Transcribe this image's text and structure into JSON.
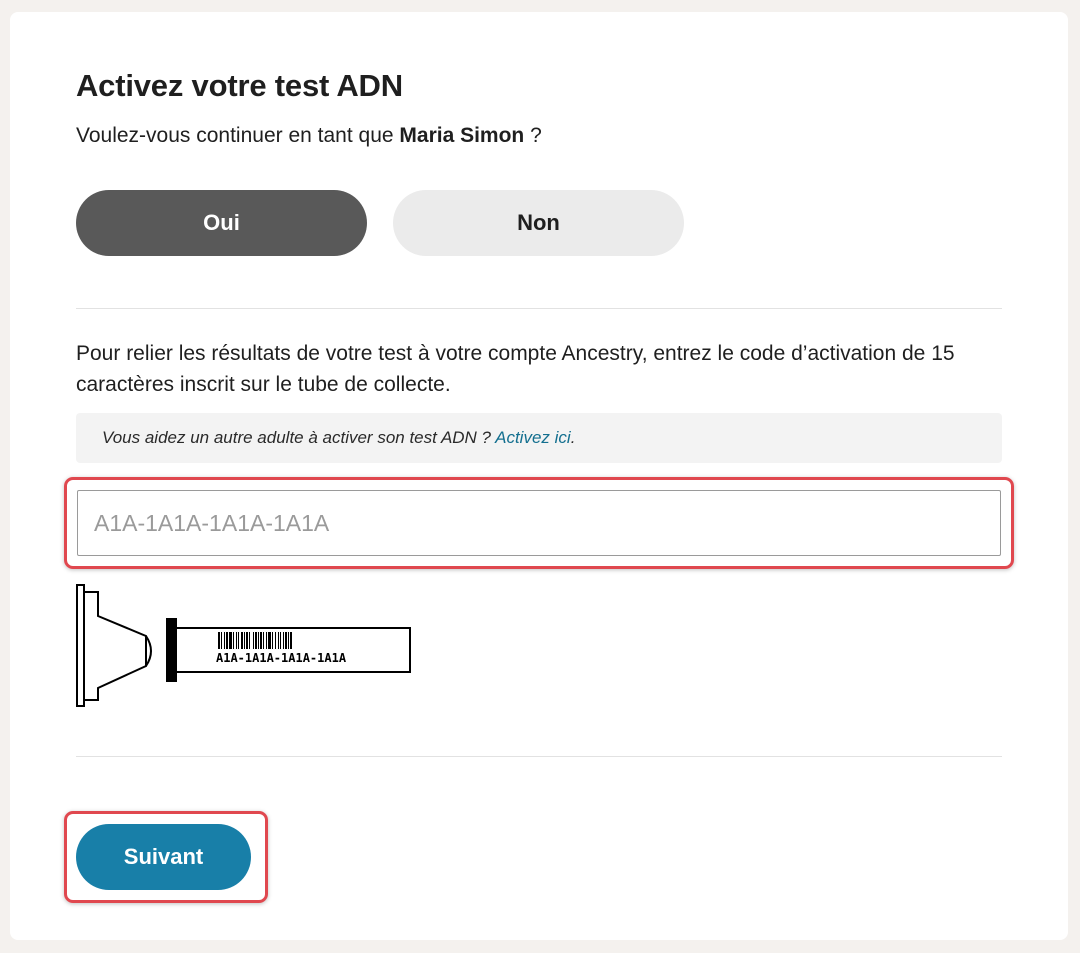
{
  "header": {
    "title": "Activez votre test ADN",
    "question_prefix": "Voulez-vous continuer en tant que ",
    "user_name": "Maria Simon",
    "question_suffix": " ?"
  },
  "choices": {
    "yes_label": "Oui",
    "no_label": "Non",
    "selected": "Oui"
  },
  "activation": {
    "instructions": "Pour relier les résultats de votre test à votre compte Ancestry, entrez le code d’activation de 15 caractères inscrit sur le tube de collecte.",
    "help_prefix": "Vous aidez un autre adulte à activer son test ADN ? ",
    "help_link": "Activez ici",
    "help_suffix": ".",
    "input_placeholder": "A1A-1A1A-1A1A-1A1A",
    "input_value": "",
    "tube_code": "A1A-1A1A-1A1A-1A1A"
  },
  "footer": {
    "next_label": "Suivant"
  },
  "colors": {
    "selected_button": "#595959",
    "unselected_button": "#ebebeb",
    "primary_button": "#187fa8",
    "link": "#136f8f",
    "highlight": "#e0484f"
  }
}
